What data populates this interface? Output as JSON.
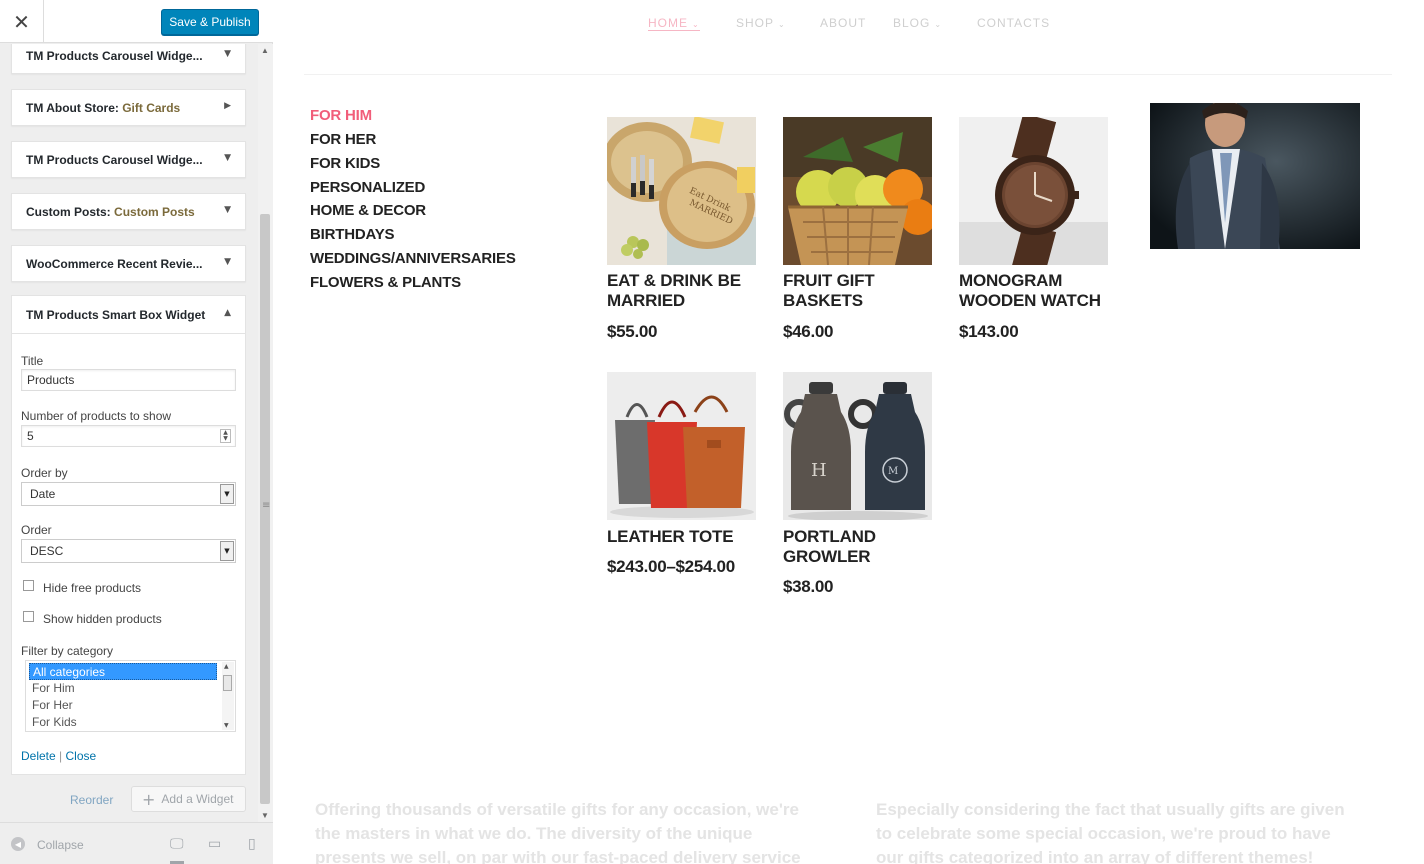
{
  "sidebar": {
    "save_label": "Save & Publish",
    "widgets": [
      {
        "title": "TM Products Carousel Widge...",
        "sub": ""
      },
      {
        "title": "TM About Store:",
        "sub": " Gift Cards"
      },
      {
        "title": "TM Products Carousel Widge...",
        "sub": ""
      },
      {
        "title": "Custom Posts:",
        "sub": " Custom Posts"
      },
      {
        "title": "WooCommerce Recent Revie...",
        "sub": ""
      }
    ],
    "open_widget": {
      "title": "TM Products Smart Box Widget",
      "title_label": "Title",
      "title_value": "Products",
      "count_label": "Number of products to show",
      "count_value": "5",
      "orderby_label": "Order by",
      "orderby_value": "Date",
      "order_label": "Order",
      "order_value": "DESC",
      "hide_free_label": "Hide free products",
      "show_hidden_label": "Show hidden products",
      "filter_label": "Filter by category",
      "categories": [
        "All categories",
        "For Him",
        "For Her",
        "For Kids"
      ],
      "delete_label": "Delete",
      "close_label": "Close"
    },
    "reorder_label": "Reorder",
    "add_widget_label": "Add a Widget",
    "collapse_label": "Collapse"
  },
  "preview": {
    "nav": [
      "HOME",
      "SHOP",
      "ABOUT",
      "BLOG",
      "CONTACTS"
    ],
    "categories": [
      "FOR HIM",
      "FOR HER",
      "FOR KIDS",
      "PERSONALIZED",
      "HOME & DECOR",
      "BIRTHDAYS",
      "WEDDINGS/ANNIVERSARIES",
      "FLOWERS & PLANTS"
    ],
    "products": [
      {
        "name": "EAT & DRINK BE MARRIED",
        "price": "$55.00"
      },
      {
        "name": "FRUIT GIFT BASKETS",
        "price": "$46.00"
      },
      {
        "name": "MONOGRAM WOODEN WATCH",
        "price": "$143.00"
      },
      {
        "name": "LEATHER TOTE",
        "price": "$243.00–$254.00"
      },
      {
        "name": "PORTLAND GROWLER",
        "price": "$38.00"
      }
    ],
    "footer_left": "Offering thousands of versatile gifts for any occasion, we're the masters in what we do. The diversity of the unique presents we sell, on par with our fast-paced delivery service form a perfect combo for",
    "footer_right": "Especially considering the fact that usually gifts are given to celebrate some special occasion, we're proud to have our gifts categorized into an array of different themes!"
  }
}
